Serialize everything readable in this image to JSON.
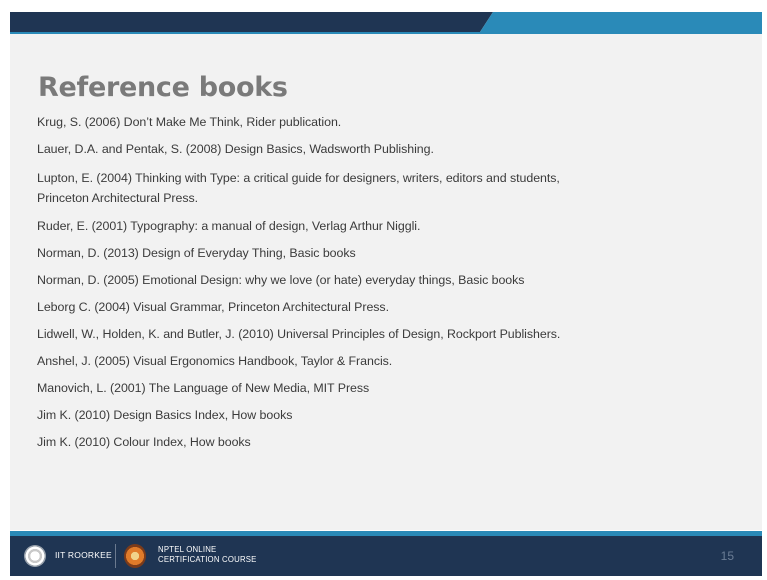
{
  "slide": {
    "title": "Reference books",
    "references": [
      "Krug, S. (2006) Don’t Make Me Think, Rider publication.",
      "Lauer, D.A. and Pentak, S. (2008) Design Basics, Wadsworth Publishing.",
      "Lupton, E. (2004) Thinking with Type: a critical guide for designers, writers, editors and students,",
      "Princeton Architectural Press.",
      "Ruder, E. (2001) Typography: a manual of design, Verlag Arthur Niggli.",
      "Norman, D. (2013) Design of Everyday Thing, Basic books",
      "Norman, D. (2005) Emotional Design: why we love (or hate) everyday things, Basic books",
      "Leborg C. (2004) Visual Grammar, Princeton Architectural Press.",
      "Lidwell, W., Holden, K. and Butler, J. (2010) Universal Principles of Design, Rockport Publishers.",
      "Anshel, J. (2005) Visual Ergonomics Handbook, Taylor & Francis.",
      "Manovich, L. (2001) The Language of New Media, MIT Press",
      "Jim K. (2010) Design Basics Index, How books",
      "Jim K. (2010) Colour Index, How books"
    ]
  },
  "footer": {
    "institute": "IIT ROORKEE",
    "course_line1": "NPTEL ONLINE",
    "course_line2": "CERTIFICATION COURSE",
    "page_number": "15"
  },
  "colors": {
    "header_dark": "#1f3553",
    "header_blue": "#2a8ab8",
    "title_gray": "#7a7a7a",
    "body_text": "#3b3b3b"
  }
}
